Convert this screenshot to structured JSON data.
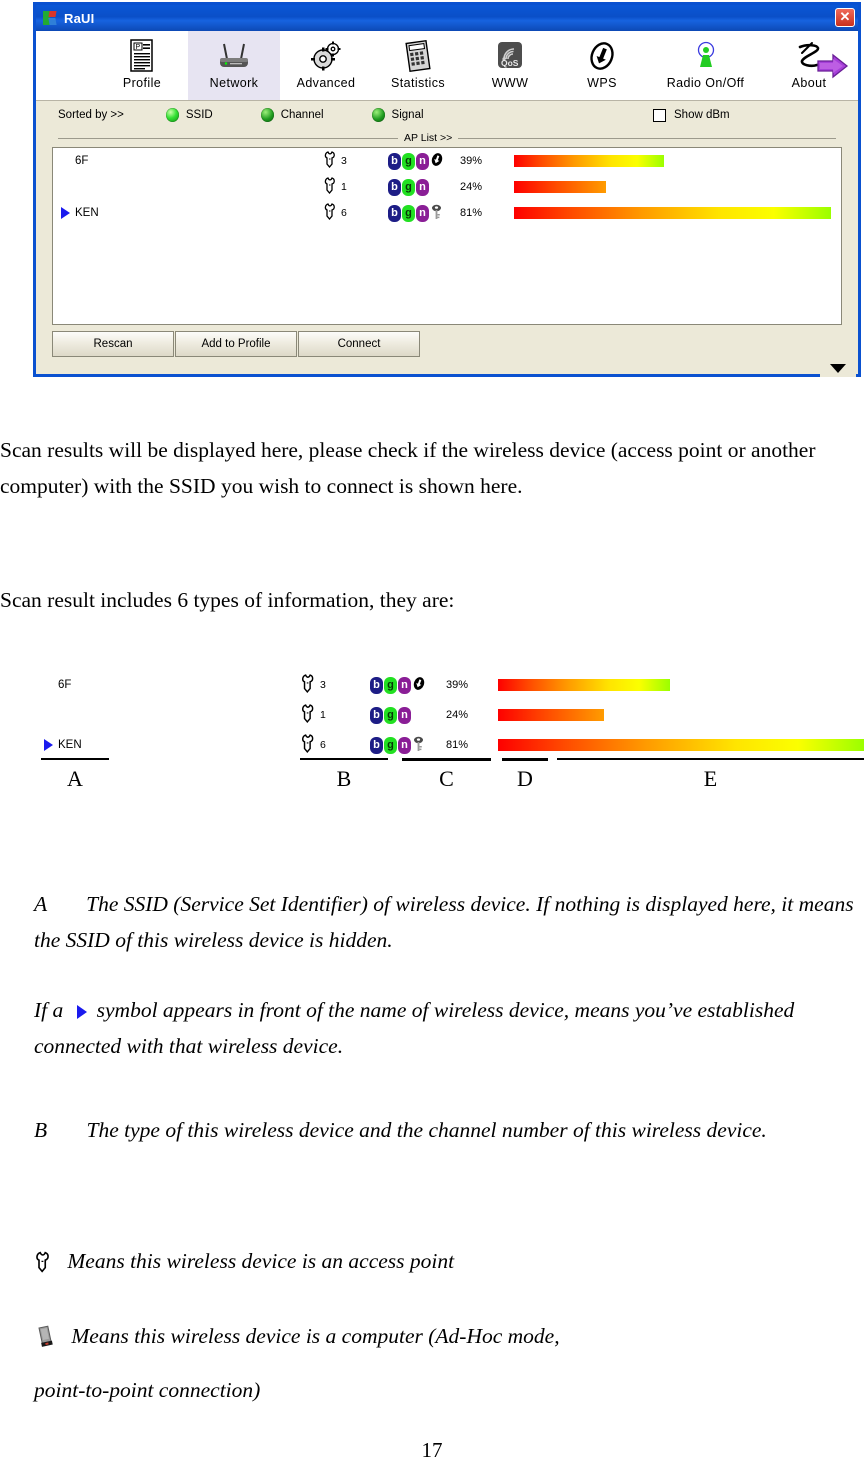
{
  "window": {
    "title": "RaUI",
    "close_label": "✕",
    "logo_name": "ralink-logo-icon",
    "toolbar": [
      {
        "label": "Profile",
        "icon": "profile-document-icon",
        "active": false
      },
      {
        "label": "Network",
        "icon": "router-icon",
        "active": true
      },
      {
        "label": "Advanced",
        "icon": "gears-icon",
        "active": false
      },
      {
        "label": "Statistics",
        "icon": "calculator-icon",
        "active": false
      },
      {
        "label": "WWW",
        "icon": "qos-signal-icon",
        "active": false
      },
      {
        "label": "WPS",
        "icon": "wps-arrows-icon",
        "active": false
      },
      {
        "label": "Radio On/Off",
        "icon": "antenna-icon",
        "active": false
      },
      {
        "label": "About",
        "icon": "ralink-z-icon",
        "active": false
      }
    ],
    "expand_arrow_icon": "purple-right-arrow-icon",
    "sortbar": {
      "sorted_by_label": "Sorted by >>",
      "options": [
        {
          "label": "SSID",
          "selected": true
        },
        {
          "label": "Channel",
          "selected": false
        },
        {
          "label": "Signal",
          "selected": false
        }
      ],
      "show_dbm_label": "Show dBm",
      "show_dbm_checked": false
    },
    "ap_list_caption": "AP List >>",
    "ap_rows": [
      {
        "ssid": "6F",
        "connected": false,
        "type_icon": "access-point-icon",
        "channel": "3",
        "modes": [
          "b",
          "g",
          "n"
        ],
        "wps": true,
        "secured": false,
        "signal_label": "39%",
        "signal_pct": 39
      },
      {
        "ssid": "",
        "connected": false,
        "type_icon": "access-point-icon",
        "channel": "1",
        "modes": [
          "b",
          "g",
          "n"
        ],
        "wps": false,
        "secured": false,
        "signal_label": "24%",
        "signal_pct": 24
      },
      {
        "ssid": "KEN",
        "connected": true,
        "type_icon": "access-point-icon",
        "channel": "6",
        "modes": [
          "b",
          "g",
          "n"
        ],
        "wps": false,
        "secured": true,
        "signal_label": "81%",
        "signal_pct": 81
      }
    ],
    "buttons": [
      {
        "label": "Rescan"
      },
      {
        "label": "Add to Profile"
      },
      {
        "label": "Connect"
      }
    ],
    "expander_icon": "chevron-down-icon"
  },
  "doc": {
    "para1": "Scan results will be displayed here, please check if the wireless device (access point or another computer) with the SSID you wish to connect is shown here.",
    "para2": "Scan result includes 6 types of information, they are:",
    "diagram_letters": [
      "A",
      "B",
      "C",
      "D",
      "E"
    ],
    "item_a_1_letter": "A",
    "item_a_1_text": "The SSID (Service Set Identifier) of wireless device. If nothing is displayed here, it means the SSID of this wireless device is hidden.",
    "item_a_2_prefix": "If a",
    "item_a_2_suffix": "symbol appears in front of the name of wireless device, means you’ve established connected with that wireless device.",
    "item_b_letter": "B",
    "item_b_text": "The type of this wireless device and the channel number of this wireless device.",
    "legend_ap_text": "Means this wireless device is an access point",
    "legend_ap_icon": "access-point-icon",
    "legend_adhoc_text": "Means this wireless device is a computer (Ad-Hoc mode,",
    "legend_adhoc_text2": "point-to-point connection)",
    "legend_adhoc_icon": "computer-adhoc-icon",
    "page_number": "17"
  },
  "colors": {
    "titlebar_blue": "#0a51d0",
    "window_border": "#0a51d0",
    "panel_beige": "#ece9d8",
    "tab_active": "#e7e4f2",
    "badge_b": "#1d1d86",
    "badge_g": "#22e022",
    "badge_n": "#8a1e96",
    "connected_triangle": "#1a1aee",
    "signal_gradient": [
      "#fe0000",
      "#ff9900",
      "#fbff00",
      "#9bff00"
    ]
  }
}
